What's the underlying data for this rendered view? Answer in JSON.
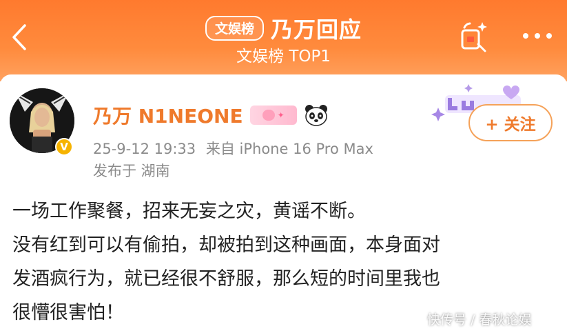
{
  "header": {
    "tag": "文娱榜",
    "title": "乃万回应",
    "subtitle": "文娱榜 TOP1",
    "colors": {
      "gradient_top": "#ff7a2e",
      "gradient_bottom": "#ffa260"
    },
    "icons": {
      "back": "back-chevron-icon",
      "share": "share-icon",
      "more": "more-dots-icon"
    }
  },
  "post": {
    "username": "乃万 N1NEONE",
    "badges": [
      "level-badge",
      "panda-emoji"
    ],
    "timestamp": "25-9-12 19:33",
    "source": "来自 iPhone 16 Pro Max",
    "location": "发布于 湖南",
    "follow_label": "+ 关注",
    "verified_icon": "verified-v-icon",
    "lines": [
      "一场工作聚餐，招来无妄之灾，黄谣不断。",
      "没有红到可以有偷拍，却被拍到这种画面，本身面对",
      "发酒疯行为，就已经很不舒服，那么短的时间里我也",
      "很懵很害怕！"
    ],
    "accent_color": "#ef7a2c"
  },
  "watermark": "快传号 / 春秋论娱"
}
